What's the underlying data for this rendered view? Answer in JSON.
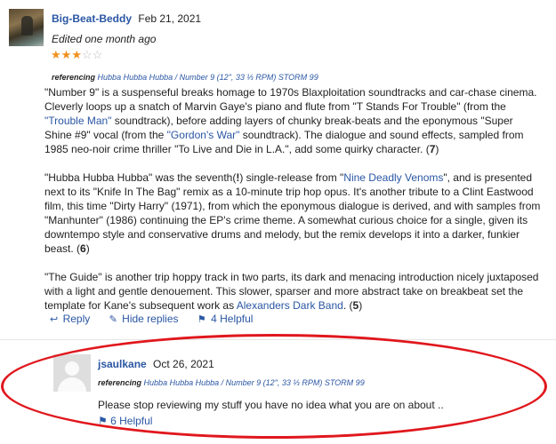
{
  "review": {
    "username": "Big-Beat-Beddy",
    "date": "Feb 21, 2021",
    "edited": "Edited one month ago",
    "rating": 3,
    "rating_max": 5,
    "referencing_label": "referencing",
    "release": "Hubba Hubba Hubba / Number 9 (12\", 33 ⅓ RPM) STORM 99",
    "paragraphs": {
      "p1": {
        "t1": "\"Number 9\" is a suspenseful breaks homage to 1970s Blaxploitation soundtracks and car-chase cinema. Cleverly loops up a snatch of Marvin Gaye's piano and flute from \"T Stands For Trouble\" (from the ",
        "l1": "\"Trouble Man\"",
        "t2": " soundtrack), before adding layers of chunky break-beats and the eponymous \"Super Shine #9\" vocal (from the ",
        "l2": "\"Gordon's War\"",
        "t3": " soundtrack). The dialogue and sound effects, sampled from 1985 neo-noir crime thriller \"To Live and Die in L.A.\", add some quirky character. (",
        "score": "7",
        "t4": ")"
      },
      "p2": {
        "t1": "\"Hubba Hubba Hubba\" was the seventh(",
        "bang": "!",
        "t2": ") single-release from \"",
        "l1": "Nine Deadly Venoms",
        "t3": "\", and is presented next to its \"Knife In The Bag\" remix as a 10-minute trip hop opus. It's another tribute to a Clint Eastwood film, this time \"Dirty Harry\" (1971), from which the eponymous dialogue is derived, and with samples from \"Manhunter\" (1986) continuing the EP's crime theme. A somewhat curious choice for a single, given its downtempo style and conservative drums and melody, but the remix develops it into a darker, funkier beast. (",
        "score": "6",
        "t4": ")"
      },
      "p3": {
        "t1": "\"The Guide\" is another trip hoppy track in two parts, its dark and menacing introduction nicely juxtaposed with a light and gentle denouement. This slower, sparser and more abstract take on breakbeat set the template for Kane's subsequent work as ",
        "l1": "Alexanders Dark Band",
        "t2": ". (",
        "score": "5",
        "t3": ")"
      }
    },
    "actions": {
      "reply": "Reply",
      "hide_replies": "Hide replies",
      "helpful": "4 Helpful"
    }
  },
  "reply": {
    "username": "jsaulkane",
    "date": "Oct 26, 2021",
    "referencing_label": "referencing",
    "release": "Hubba Hubba Hubba / Number 9 (12\", 33 ⅓ RPM) STORM 99",
    "text": "Please stop reviewing my stuff you have no idea what you are on about ..",
    "helpful": "6 Helpful"
  },
  "icons": {
    "reply": "reply-arrow-icon",
    "hide_replies": "replies-icon",
    "helpful": "tag-icon"
  },
  "colors": {
    "link": "#2a56a3",
    "star": "#f0901c",
    "highlight": "#e0171d"
  }
}
